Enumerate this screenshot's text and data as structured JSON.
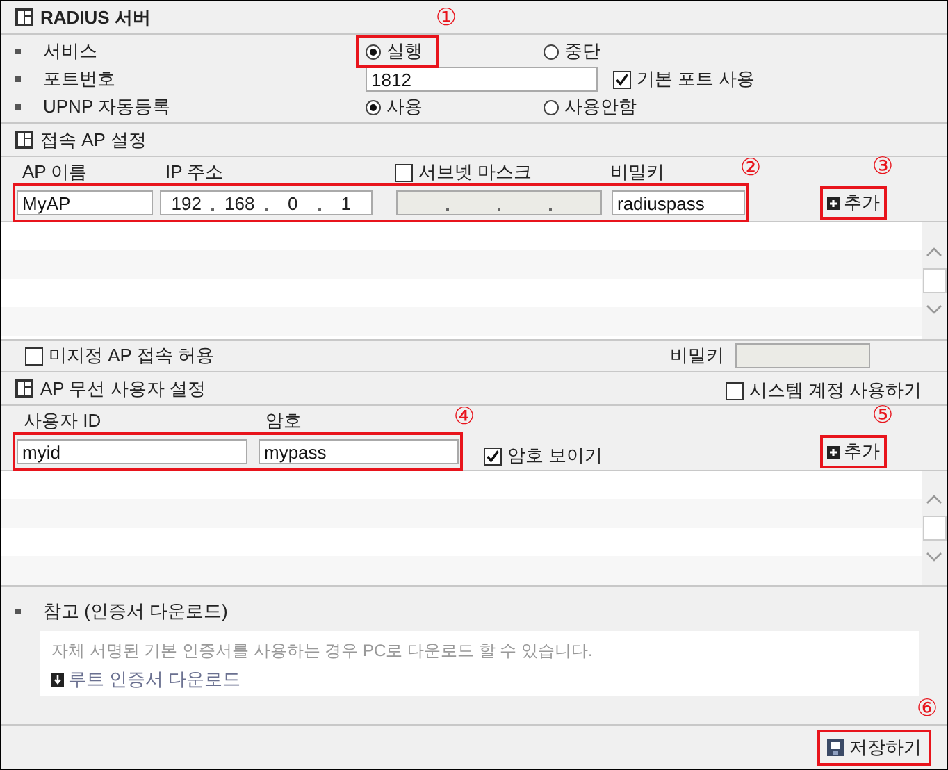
{
  "radius_server": {
    "title": "RADIUS 서버",
    "rows": [
      {
        "label": "서비스",
        "kind": "radio",
        "options": [
          {
            "label": "실행",
            "selected": true,
            "callout": "①"
          },
          {
            "label": "중단",
            "selected": false
          }
        ]
      },
      {
        "label": "포트번호",
        "kind": "port",
        "value": "1812",
        "checkbox": {
          "label": "기본 포트 사용",
          "checked": true
        }
      },
      {
        "label": "UPNP 자동등록",
        "kind": "radio",
        "options": [
          {
            "label": "사용",
            "selected": true
          },
          {
            "label": "사용안함",
            "selected": false
          }
        ]
      }
    ]
  },
  "ap_settings": {
    "title": "접속 AP 설정",
    "columns": {
      "ap_name": "AP 이름",
      "ip": "IP 주소",
      "subnet_mask": {
        "label": "서브넷 마스크",
        "checked": false
      },
      "secret": "비밀키"
    },
    "ap_name": "MyAP",
    "ip": [
      "192",
      "168",
      "0",
      "1"
    ],
    "secret": "radiuspass",
    "callout": "②",
    "add_button": {
      "label": "추가",
      "callout": "③"
    },
    "allow_unassigned": {
      "label": "미지정 AP 접속 허용",
      "checked": false
    },
    "unassigned_secret_label": "비밀키"
  },
  "wireless_users": {
    "title": "AP 무선 사용자 설정",
    "system_account": {
      "label": "시스템 계정 사용하기",
      "checked": false
    },
    "columns": [
      "사용자 ID",
      "암호"
    ],
    "user_id": "myid",
    "password": "mypass",
    "callout": "④",
    "show_password": {
      "label": "암호 보이기",
      "checked": true
    },
    "add_button": {
      "label": "추가",
      "callout": "⑤"
    }
  },
  "note": {
    "title": "참고 (인증서 다운로드)",
    "text": "자체 서명된 기본 인증서를 사용하는 경우 PC로 다운로드 할 수 있습니다.",
    "link": "루트 인증서 다운로드"
  },
  "save_button": {
    "label": "저장하기",
    "callout": "⑥"
  }
}
